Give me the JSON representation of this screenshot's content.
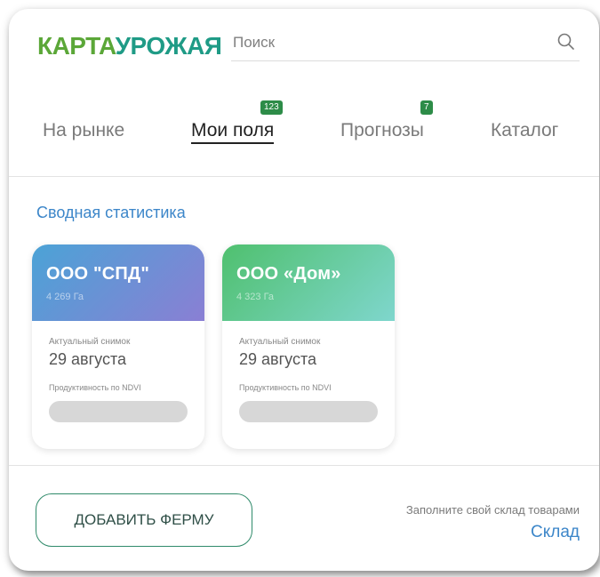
{
  "brand": {
    "logo_part1": "КАРТА",
    "logo_part2": "УРОЖАЯ"
  },
  "search": {
    "placeholder": "Поиск",
    "value": ""
  },
  "icons": {
    "search": "search-icon"
  },
  "tabs": [
    {
      "label": "На рынке",
      "badge": ""
    },
    {
      "label": "Мои поля",
      "badge": "123"
    },
    {
      "label": "Прогнозы",
      "badge": "7"
    },
    {
      "label": "Каталог",
      "badge": ""
    }
  ],
  "active_tab": "Мои поля",
  "summary": {
    "title": "Сводная статистика",
    "cards": [
      {
        "name": "ООО \"СПД\"",
        "area": "4 269 Га",
        "snapshot_label": "Актуальный снимок",
        "snapshot_date": "29 августа",
        "ndvi_label": "Продуктивность по NDVI"
      },
      {
        "name": "ООО «Дом»",
        "area": "4 323 Га",
        "snapshot_label": "Актуальный снимок",
        "snapshot_date": "29 августа",
        "ndvi_label": "Продуктивность по NDVI"
      }
    ]
  },
  "footer": {
    "add_farm_label": "ДОБАВИТЬ ФЕРМУ",
    "warehouse_hint": "Заполните свой склад товарами",
    "warehouse_link": "Склад"
  },
  "colors": {
    "logo_green": "#5ba738",
    "logo_teal": "#1f9b86",
    "badge": "#2d8c48",
    "link_blue": "#3c86c9",
    "card1_gradient": [
      "#4ba3d6",
      "#8a7fd4"
    ],
    "card2_gradient": [
      "#4fc06e",
      "#7fd6cd"
    ]
  }
}
